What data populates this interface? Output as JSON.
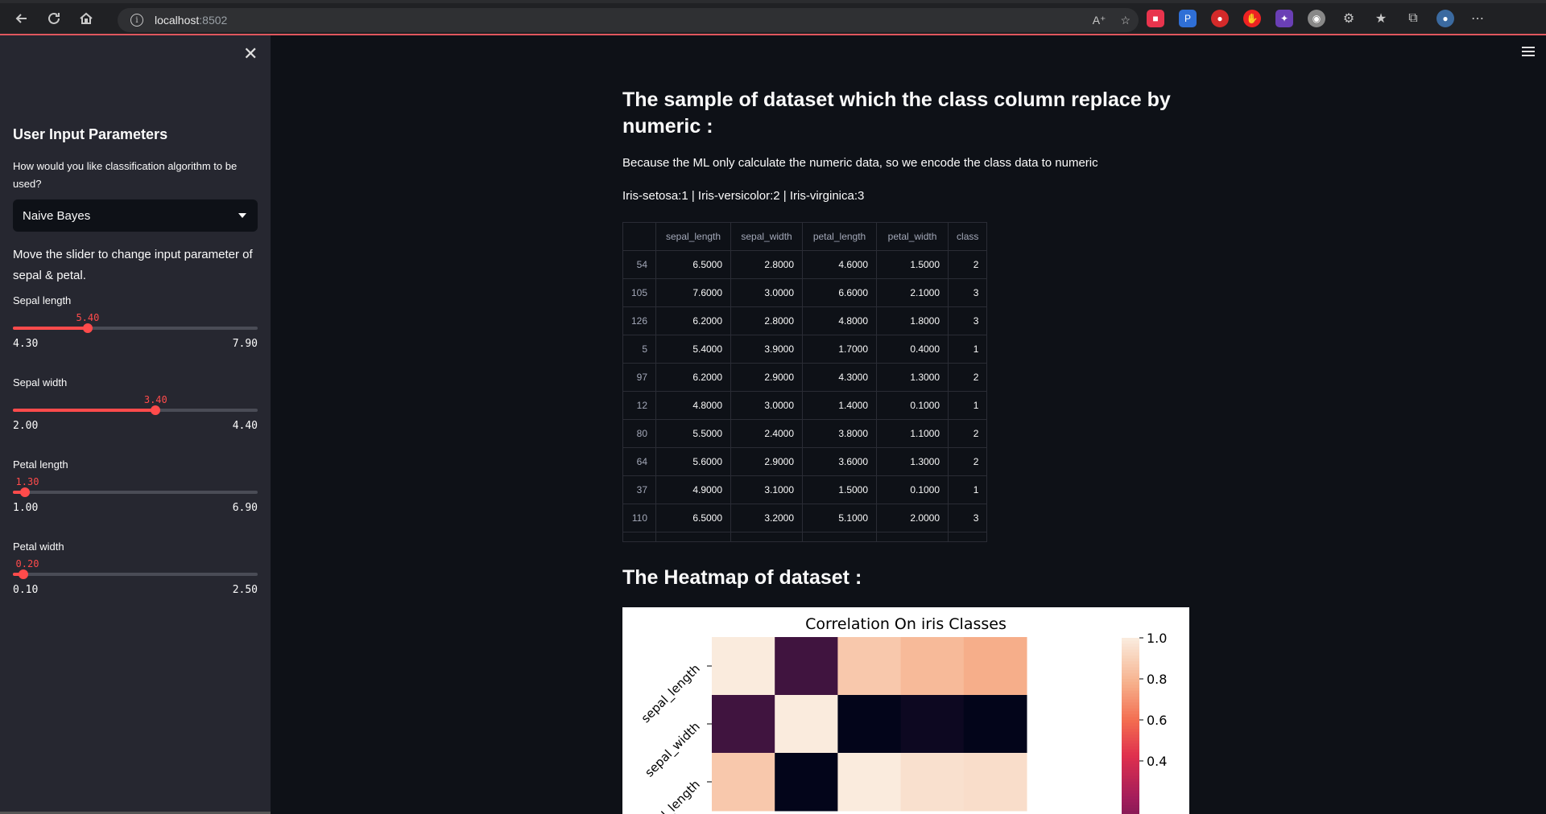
{
  "browser": {
    "url_host": "localhost",
    "url_port": ":8502"
  },
  "sidebar": {
    "title": "User Input Parameters",
    "algorithm_question": "How would you like classification algorithm to be used?",
    "algorithm_selected": "Naive Bayes",
    "slider_instruction": "Move the slider to change input parameter of sepal & petal.",
    "sliders": [
      {
        "label": "Sepal length",
        "value": "5.40",
        "min": "4.30",
        "max": "7.90",
        "fraction": 0.3056
      },
      {
        "label": "Sepal width",
        "value": "3.40",
        "min": "2.00",
        "max": "4.40",
        "fraction": 0.5833
      },
      {
        "label": "Petal length",
        "value": "1.30",
        "min": "1.00",
        "max": "6.90",
        "fraction": 0.0508
      },
      {
        "label": "Petal width",
        "value": "0.20",
        "min": "0.10",
        "max": "2.50",
        "fraction": 0.0417
      }
    ]
  },
  "main": {
    "heading_sample": "The sample of dataset which the class column replace by numeric :",
    "explanation": "Because the ML only calculate the numeric data, so we encode the class data to numeric",
    "class_mapping": "Iris-setosa:1 | Iris-versicolor:2 | Iris-virginica:3",
    "table": {
      "columns": [
        "",
        "sepal_length",
        "sepal_width",
        "petal_length",
        "petal_width",
        "class"
      ],
      "rows": [
        [
          "54",
          "6.5000",
          "2.8000",
          "4.6000",
          "1.5000",
          "2"
        ],
        [
          "105",
          "7.6000",
          "3.0000",
          "6.6000",
          "2.1000",
          "3"
        ],
        [
          "126",
          "6.2000",
          "2.8000",
          "4.8000",
          "1.8000",
          "3"
        ],
        [
          "5",
          "5.4000",
          "3.9000",
          "1.7000",
          "0.4000",
          "1"
        ],
        [
          "97",
          "6.2000",
          "2.9000",
          "4.3000",
          "1.3000",
          "2"
        ],
        [
          "12",
          "4.8000",
          "3.0000",
          "1.4000",
          "0.1000",
          "1"
        ],
        [
          "80",
          "5.5000",
          "2.4000",
          "3.8000",
          "1.1000",
          "2"
        ],
        [
          "64",
          "5.6000",
          "2.9000",
          "3.6000",
          "1.3000",
          "2"
        ],
        [
          "37",
          "4.9000",
          "3.1000",
          "1.5000",
          "0.1000",
          "1"
        ],
        [
          "110",
          "6.5000",
          "3.2000",
          "5.1000",
          "2.0000",
          "3"
        ]
      ]
    },
    "heading_heatmap": "The Heatmap of dataset :"
  },
  "chart_data": {
    "type": "heatmap",
    "title": "Correlation On iris Classes",
    "row_labels": [
      "sepal_length",
      "sepal_width",
      "petal_length"
    ],
    "values": [
      [
        1.0,
        -0.11,
        0.87,
        0.82,
        0.78
      ],
      [
        -0.11,
        1.0,
        -0.42,
        -0.36,
        -0.42
      ],
      [
        0.87,
        -0.42,
        1.0,
        0.96,
        0.95
      ]
    ],
    "colorbar_ticks": [
      "1.0",
      "0.8",
      "0.6",
      "0.4"
    ],
    "colorbar_range": [
      -0.42,
      1.0
    ],
    "colormap": "rocket"
  }
}
